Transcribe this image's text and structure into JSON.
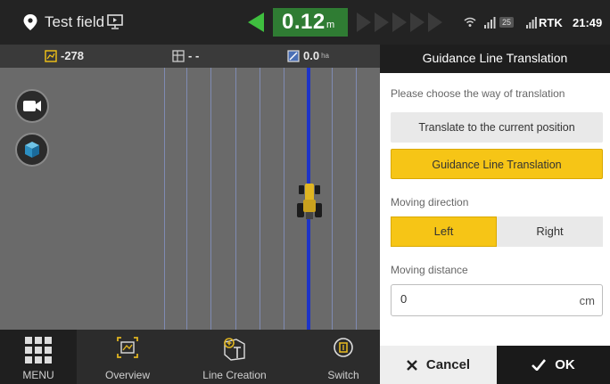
{
  "status_bar": {
    "field_name": "Test field",
    "offset_value": "0.12",
    "offset_unit": "m",
    "satellite_count": "25",
    "rtk_label": "RTK",
    "time": "21:49",
    "accent_color": "#2f7c33"
  },
  "info_strip": {
    "area_value": "-278",
    "field_value": "- -",
    "worked_area_value": "0.0",
    "worked_area_unit": "ha"
  },
  "bottom_nav": {
    "menu_label": "MENU",
    "overview_label": "Overview",
    "line_creation_label": "Line Creation",
    "switch_label": "Switch"
  },
  "panel": {
    "title": "Guidance Line Translation",
    "prompt": "Please choose the way of translation",
    "option_current": "Translate to the current position",
    "option_guidance": "Guidance Line Translation",
    "selected_option": "Guidance Line Translation",
    "direction_label": "Moving direction",
    "direction_left": "Left",
    "direction_right": "Right",
    "selected_direction": "Left",
    "distance_label": "Moving distance",
    "distance_value": "0",
    "distance_unit": "cm",
    "cancel_label": "Cancel",
    "ok_label": "OK",
    "highlight_color": "#f6c516"
  }
}
